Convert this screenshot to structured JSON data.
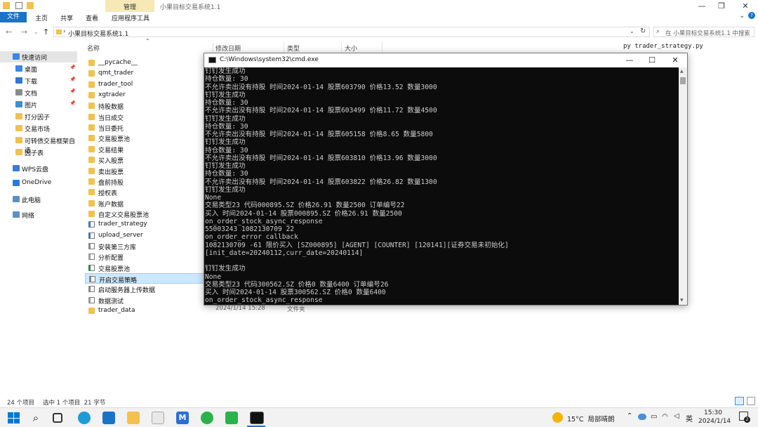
{
  "window": {
    "title": "小果目标交易系统1.1",
    "context_tab_label": "管理",
    "controls": {
      "minimize": "—",
      "maximize": "❐",
      "close": "✕"
    }
  },
  "ribbon": {
    "tabs": [
      "文件",
      "主页",
      "共享",
      "查看",
      "应用程序工具"
    ]
  },
  "address": {
    "path": "小果目标交易系统1.1",
    "search_placeholder": "在 小果目标交易系统1.1 中搜索"
  },
  "sidebar": {
    "items": [
      {
        "label": "快速访问",
        "icon": "star-icon",
        "pinned": false
      },
      {
        "label": "桌面",
        "icon": "desktop-icon",
        "pinned": true
      },
      {
        "label": "下载",
        "icon": "download-icon",
        "pinned": true
      },
      {
        "label": "文档",
        "icon": "document-icon",
        "pinned": true
      },
      {
        "label": "图片",
        "icon": "pictures-icon",
        "pinned": true
      },
      {
        "label": "打分因子",
        "icon": "folder-icon",
        "pinned": false
      },
      {
        "label": "交易市场",
        "icon": "folder-icon",
        "pinned": false
      },
      {
        "label": "可转债交易框架自选",
        "icon": "folder-icon",
        "pinned": false
      },
      {
        "label": "因子表",
        "icon": "folder-icon",
        "pinned": false
      },
      {
        "label": "WPS云盘",
        "icon": "cloud-icon",
        "pinned": false
      },
      {
        "label": "OneDrive",
        "icon": "onedrive-icon",
        "pinned": false
      },
      {
        "label": "此电脑",
        "icon": "computer-icon",
        "pinned": false
      },
      {
        "label": "网络",
        "icon": "network-icon",
        "pinned": false
      }
    ]
  },
  "columns": {
    "name": "名称",
    "modified": "修改日期",
    "type": "类型",
    "size": "大小"
  },
  "files": [
    {
      "name": "__pycache__",
      "kind": "folder"
    },
    {
      "name": "qmt_trader",
      "kind": "folder"
    },
    {
      "name": "trader_tool",
      "kind": "folder"
    },
    {
      "name": "xgtrader",
      "kind": "folder"
    },
    {
      "name": "持股数据",
      "kind": "folder"
    },
    {
      "name": "当日成交",
      "kind": "folder"
    },
    {
      "name": "当日委托",
      "kind": "folder"
    },
    {
      "name": "交易股票池",
      "kind": "folder"
    },
    {
      "name": "交易结果",
      "kind": "folder"
    },
    {
      "name": "买入股票",
      "kind": "folder"
    },
    {
      "name": "卖出股票",
      "kind": "folder"
    },
    {
      "name": "盘前持股",
      "kind": "folder"
    },
    {
      "name": "授权表",
      "kind": "folder"
    },
    {
      "name": "账户数据",
      "kind": "folder"
    },
    {
      "name": "自定义交易股票池",
      "kind": "folder"
    },
    {
      "name": "trader_strategy",
      "kind": "python"
    },
    {
      "name": "upload_server",
      "kind": "python"
    },
    {
      "name": "安装第三方库",
      "kind": "bat"
    },
    {
      "name": "分析配置",
      "kind": "text"
    },
    {
      "name": "交易股票池",
      "kind": "excel"
    },
    {
      "name": "开启交易策略",
      "kind": "bat",
      "selected": true
    },
    {
      "name": "启动服务器上传数据",
      "kind": "bat"
    },
    {
      "name": "数据测试",
      "kind": "text"
    },
    {
      "name": "trader_data",
      "kind": "folder"
    }
  ],
  "last_row_date": "2024/1/14 15:28",
  "last_row_type": "文件夹",
  "bg_command": "py trader_strategy.py",
  "cmd": {
    "title": "C:\\Windows\\system32\\cmd.exe",
    "lines": [
      "钉钉发生成功",
      "持仓数量: 30",
      "不允许卖出没有持股 时间2024-01-14 股票603790 价格13.52 数量3000",
      "钉钉发生成功",
      "持仓数量: 30",
      "不允许卖出没有持股 时间2024-01-14 股票603499 价格11.72 数量4500",
      "钉钉发生成功",
      "持仓数量: 30",
      "不允许卖出没有持股 时间2024-01-14 股票605158 价格8.65 数量5800",
      "钉钉发生成功",
      "持仓数量: 30",
      "不允许卖出没有持股 时间2024-01-14 股票603810 价格13.96 数量3000",
      "钉钉发生成功",
      "持仓数量: 30",
      "不允许卖出没有持股 时间2024-01-14 股票603822 价格26.82 数量1300",
      "钉钉发生成功",
      "None",
      "交易类型23 代码000895.SZ 价格26.91 数量2500 订单编号22",
      "买入 时间2024-01-14 股票000895.SZ 价格26.91 数量2500",
      "on_order_stock_async_response",
      "55003243 1082130709 22",
      "on_order_error callback",
      "1082130709 -61 限价买入 [SZ000895] [AGENT] [COUNTER] [120141][证券交易未初始化]",
      "[init_date=20240112,curr_date=20240114]",
      "",
      "钉钉发生成功",
      "None",
      "交易类型23 代码300562.SZ 价格0 数量6400 订单编号26",
      "买入 时间2024-01-14 股票300562.SZ 价格0 数量6400",
      "on_order_stock_async_response"
    ]
  },
  "status": {
    "count": "24 个项目",
    "selected": "选中 1 个项目  21 字节"
  },
  "taskbar": {
    "weather": "15°C  局部晴朗",
    "ime": "英",
    "time": "15:30",
    "date": "2024/1/14"
  },
  "colors": {
    "accent": "#1a73c7",
    "context_tab": "#f7e9b5",
    "console_bg": "#0c0c0c",
    "console_fg": "#cccccc",
    "selected_row": "#cce8ff"
  }
}
